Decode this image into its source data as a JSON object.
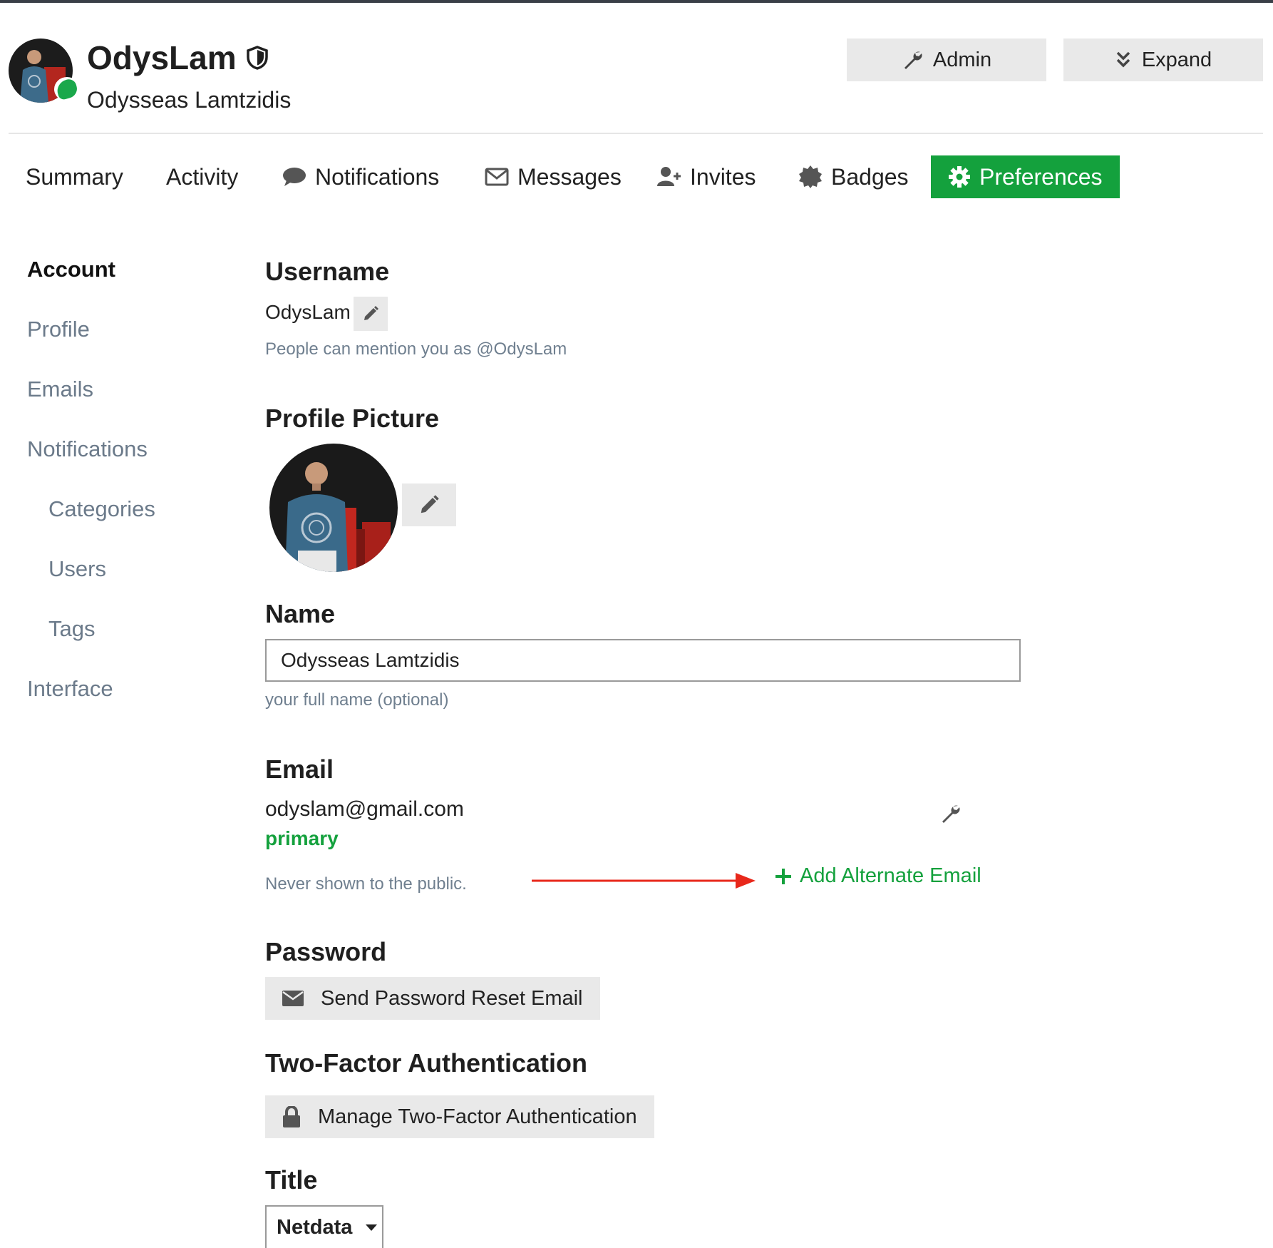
{
  "header": {
    "username": "OdysLam",
    "full_name": "Odysseas Lamtzidis",
    "admin_label": "Admin",
    "expand_label": "Expand"
  },
  "nav": {
    "items": [
      {
        "label": "Summary",
        "icon": ""
      },
      {
        "label": "Activity",
        "icon": ""
      },
      {
        "label": "Notifications",
        "icon": "comment-icon"
      },
      {
        "label": "Messages",
        "icon": "envelope-icon"
      },
      {
        "label": "Invites",
        "icon": "user-plus-icon"
      },
      {
        "label": "Badges",
        "icon": "certificate-icon"
      },
      {
        "label": "Preferences",
        "icon": "gear-icon",
        "active": true
      }
    ]
  },
  "sidebar": {
    "items": [
      {
        "label": "Account",
        "active": true
      },
      {
        "label": "Profile"
      },
      {
        "label": "Emails"
      },
      {
        "label": "Notifications"
      },
      {
        "label": "Categories"
      },
      {
        "label": "Users"
      },
      {
        "label": "Tags"
      },
      {
        "label": "Interface"
      }
    ]
  },
  "account": {
    "username_heading": "Username",
    "username_value": "OdysLam",
    "username_hint": "People can mention you as @OdysLam",
    "picture_heading": "Profile Picture",
    "name_heading": "Name",
    "name_value": "Odysseas Lamtzidis",
    "name_hint": "your full name (optional)",
    "email_heading": "Email",
    "email_value": "odyslam@gmail.com",
    "email_primary": "primary",
    "email_hint": "Never shown to the public.",
    "add_alt_email": "Add Alternate Email",
    "password_heading": "Password",
    "password_button": "Send Password Reset Email",
    "twofa_heading": "Two-Factor Authentication",
    "twofa_button": "Manage Two-Factor Authentication",
    "title_heading": "Title",
    "title_value": "Netdata"
  },
  "colors": {
    "accent": "#14a13d",
    "annotation_arrow": "#e8281b",
    "muted_text": "#6f7f8f",
    "button_bg": "#e9e9e9"
  }
}
